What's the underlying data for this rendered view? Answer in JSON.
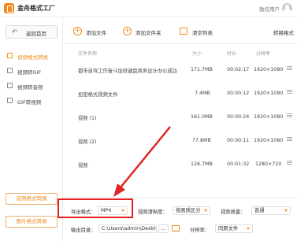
{
  "app": {
    "title": "金舟格式工厂",
    "user_label": "微信用户"
  },
  "sidebar": {
    "home_button": "返回首页",
    "items": [
      {
        "label": "视频格式转换",
        "active": true
      },
      {
        "label": "视频转GIF",
        "active": false
      },
      {
        "label": "视频转音频",
        "active": false
      },
      {
        "label": "GIF转视频",
        "active": false
      }
    ],
    "bottom_buttons": [
      "音频格式转换",
      "图片格式转换"
    ]
  },
  "toolbar": {
    "add_file": "添加文件",
    "add_folder": "添加文件夹",
    "clear_list": "清空列表",
    "convert_format": "转换格式"
  },
  "table": {
    "columns": [
      "文件名称",
      "大小",
      "时长",
      "分辨率"
    ],
    "rows": [
      {
        "name": "都市自驾工作奋斗加班键盘商务设计办公成功",
        "size": "171.7MB",
        "duration": "00:02:17",
        "resolution": "1920×1080"
      },
      {
        "name": "加密格式视频文件",
        "size": "7.4MB",
        "duration": "00:00:12",
        "resolution": "1920×1080"
      },
      {
        "name": "视频 (1)",
        "size": "161.0MB",
        "duration": "00:00:24",
        "resolution": "1920×1080"
      },
      {
        "name": "视频 (2)",
        "size": "77.8MB",
        "duration": "00:00:11",
        "resolution": "1920×1080"
      },
      {
        "name": "视频",
        "size": "126.7MB",
        "duration": "00:01:32",
        "resolution": "1280×720"
      }
    ]
  },
  "settings": {
    "output_format_label": "导出格式：",
    "output_format_value": "MP4",
    "clarity_label": "视频清晰度：",
    "clarity_value": "按画质区分",
    "quality_label": "视频质量：",
    "quality_value": "普通",
    "output_dir_label": "输出目录：",
    "output_dir_value": "C:\\Users\\admin\\Desktop\\",
    "browse_label": "...",
    "resolution_label": "分辨率：",
    "resolution_value": "同原文件"
  },
  "colors": {
    "accent": "#f08a1c",
    "highlight": "#e32222"
  }
}
